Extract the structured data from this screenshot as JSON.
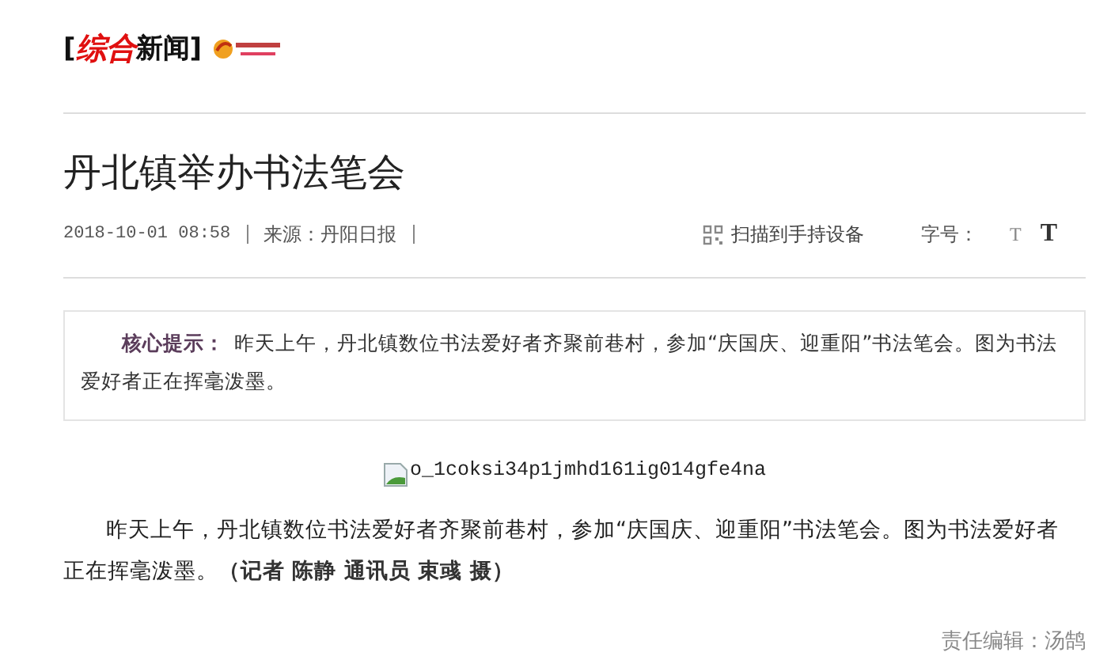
{
  "logo": {
    "segments": [
      {
        "text": "[",
        "accent": false
      },
      {
        "text": "综合",
        "accent": true
      },
      {
        "text": "新闻",
        "accent": false
      },
      {
        "text": "]",
        "accent": false
      }
    ]
  },
  "article": {
    "title": "丹北镇举办书法笔会",
    "meta": {
      "datetime": "2018-10-01 08:58",
      "source": "来源：丹阳日报",
      "scan": "扫描到手持设备",
      "font_size_label": "字号：",
      "font_sizes": [
        "T",
        "T"
      ]
    },
    "summary": {
      "label": "核心提示：",
      "text": "昨天上午，丹北镇数位书法爱好者齐聚前巷村，参加“庆国庆、迎重阳”书法笔会。图为书法爱好者正在挥毫泼墨。"
    },
    "image": {
      "alt": "o_1coksi34p1jmhd161ig014gfe4na"
    },
    "paragraph": "昨天上午，丹北镇数位书法爱好者齐聚前巷村，参加“庆国庆、迎重阳”书法笔会。图为书法爱好者正在挥毫泼墨。**（记者 陈静 通讯员 束彧 摄）**",
    "editor": "责任编辑：汤鹄"
  }
}
